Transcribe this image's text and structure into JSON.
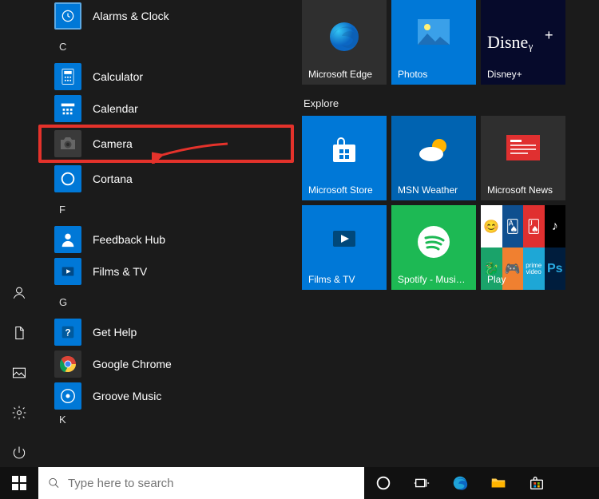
{
  "rail": {
    "user": "user-account",
    "documents": "documents",
    "pictures": "pictures",
    "settings": "settings",
    "power": "power"
  },
  "letters": {
    "c": "C",
    "f": "F",
    "g": "G",
    "k": "K"
  },
  "apps": {
    "alarms": {
      "label": "Alarms & Clock"
    },
    "calc": {
      "label": "Calculator"
    },
    "calendar": {
      "label": "Calendar"
    },
    "camera": {
      "label": "Camera"
    },
    "cortana": {
      "label": "Cortana"
    },
    "feedback": {
      "label": "Feedback Hub"
    },
    "films": {
      "label": "Films & TV"
    },
    "gethelp": {
      "label": "Get Help"
    },
    "chrome": {
      "label": "Google Chrome"
    },
    "groove": {
      "label": "Groove Music"
    }
  },
  "tiles": {
    "group_explore": "Explore",
    "edge": {
      "label": "Microsoft Edge",
      "bg": "#2f2f2f"
    },
    "photos": {
      "label": "Photos",
      "bg": "#0078d7"
    },
    "disney": {
      "label": "Disney+",
      "bg": "#060a2b"
    },
    "store": {
      "label": "Microsoft Store",
      "bg": "#0078d7"
    },
    "weather": {
      "label": "MSN Weather",
      "bg": "#0063b1"
    },
    "news": {
      "label": "Microsoft News",
      "bg": "#2f2f2f"
    },
    "filmstv": {
      "label": "Films & TV",
      "bg": "#0078d7"
    },
    "spotify": {
      "label": "Spotify - Musi…",
      "bg": "#1db954"
    },
    "play": {
      "label": "Play",
      "bg": "#0078d7"
    }
  },
  "search": {
    "placeholder": "Type here to search"
  },
  "colors": {
    "accent": "#0078d7",
    "highlight_border": "#e4322b"
  }
}
